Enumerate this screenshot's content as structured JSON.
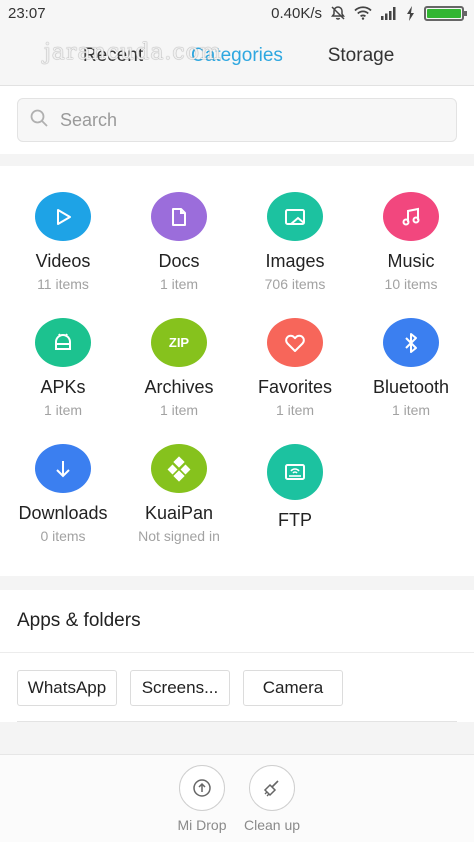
{
  "status_bar": {
    "time": "23:07",
    "network_speed": "0.40K/s",
    "icons": [
      "mute-icon",
      "wifi-icon",
      "signal-icon",
      "charging-icon",
      "battery-icon"
    ],
    "battery_level": 1.0
  },
  "watermark": "jarancuda.com",
  "tabs": {
    "recent": "Recent",
    "categories": "Categories",
    "storage": "Storage",
    "active": "categories",
    "active_color": "#2ea7e0"
  },
  "search": {
    "placeholder": "Search"
  },
  "categories": [
    {
      "label": "Videos",
      "sub": "11 items",
      "icon": "play-icon",
      "color": "#1ea3e6"
    },
    {
      "label": "Docs",
      "sub": "1 item",
      "icon": "document-icon",
      "color": "#9b6ddb"
    },
    {
      "label": "Images",
      "sub": "706 items",
      "icon": "image-icon",
      "color": "#1cc2a0"
    },
    {
      "label": "Music",
      "sub": "10 items",
      "icon": "music-icon",
      "color": "#f2477e"
    },
    {
      "label": "APKs",
      "sub": "1 item",
      "icon": "android-icon",
      "color": "#1cc28f"
    },
    {
      "label": "Archives",
      "sub": "1 item",
      "icon": "zip-icon",
      "color": "#86c21d",
      "icon_text": "ZIP"
    },
    {
      "label": "Favorites",
      "sub": "1 item",
      "icon": "heart-icon",
      "color": "#f7665a"
    },
    {
      "label": "Bluetooth",
      "sub": "1 item",
      "icon": "bluetooth-icon",
      "color": "#3b7ff0"
    },
    {
      "label": "Downloads",
      "sub": "0 items",
      "icon": "download-icon",
      "color": "#3b7ff0"
    },
    {
      "label": "KuaiPan",
      "sub": "Not signed in",
      "icon": "kuaipan-icon",
      "color": "#86c21d"
    },
    {
      "label": "FTP",
      "sub": "",
      "icon": "ftp-icon",
      "color": "#1cc2a0"
    }
  ],
  "apps_folders": {
    "title": "Apps & folders",
    "chips": [
      "WhatsApp",
      "Screens...",
      "Camera"
    ]
  },
  "bottom_bar": {
    "mi_drop": "Mi Drop",
    "clean_up": "Clean up"
  }
}
